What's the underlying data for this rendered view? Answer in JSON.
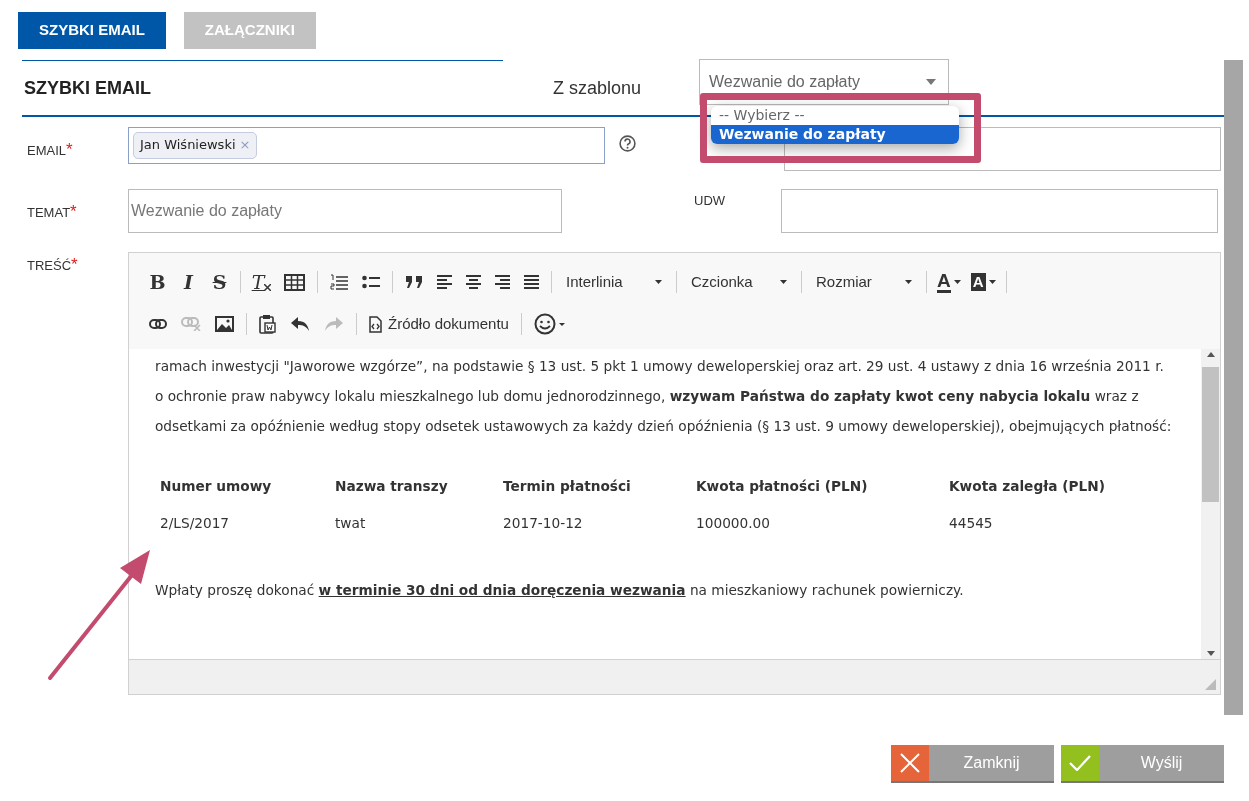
{
  "tabs": [
    {
      "label": "SZYBKI EMAIL",
      "selected": true
    },
    {
      "label": "ZAŁĄCZNIKI",
      "selected": false
    }
  ],
  "header": {
    "title": "SZYBKI EMAIL",
    "template_label": "Z szablonu",
    "template_select": {
      "value": "Wezwanie do zapłaty",
      "expanded": true,
      "options": [
        {
          "label": "-- Wybierz --",
          "selected": false
        },
        {
          "label": "Wezwanie do zapłaty",
          "selected": true
        }
      ]
    }
  },
  "fields": {
    "email": {
      "label": "EMAIL",
      "required_mark": "*",
      "chips": [
        {
          "label": "Jan Wiśniewski",
          "remove": "×"
        }
      ]
    },
    "subject": {
      "label": "TEMAT",
      "required_mark": "*",
      "placeholder": "Wezwanie do zapłaty"
    },
    "udw": {
      "label": "UDW"
    },
    "body": {
      "label": "TREŚĆ",
      "required_mark": "*"
    }
  },
  "toolbar": [
    [
      {
        "kind": "bold",
        "label": "B"
      },
      {
        "kind": "italic",
        "label": "I"
      },
      {
        "kind": "strike",
        "label": "S"
      },
      {
        "kind": "separator"
      },
      {
        "kind": "clear",
        "label": "T"
      },
      {
        "kind": "icon",
        "disabled": false
      },
      {
        "kind": "separator"
      },
      {
        "kind": "icon",
        "disabled": false
      },
      {
        "kind": "icon",
        "disabled": false
      },
      {
        "kind": "separator"
      },
      {
        "kind": "icon",
        "disabled": false
      },
      {
        "kind": "icon",
        "disabled": false
      },
      {
        "kind": "icon",
        "disabled": false
      },
      {
        "kind": "icon",
        "disabled": false
      },
      {
        "kind": "icon",
        "disabled": false
      },
      {
        "kind": "separator"
      },
      {
        "kind": "combo",
        "label": "Interlinia"
      },
      {
        "kind": "separator"
      },
      {
        "kind": "combo",
        "label": "Czcionka"
      },
      {
        "kind": "separator"
      },
      {
        "kind": "combo",
        "label": "Rozmiar"
      },
      {
        "kind": "separator"
      },
      {
        "kind": "color",
        "label": "A"
      },
      {
        "kind": "highlight",
        "label": "A"
      },
      {
        "kind": "separator"
      }
    ],
    [
      {
        "kind": "icon",
        "disabled": false
      },
      {
        "kind": "icon",
        "disabled": true
      },
      {
        "kind": "icon",
        "disabled": false
      },
      {
        "kind": "separator"
      },
      {
        "kind": "icon",
        "disabled": false
      },
      {
        "kind": "icon",
        "disabled": false
      },
      {
        "kind": "icon",
        "disabled": true
      },
      {
        "kind": "separator"
      },
      {
        "kind": "button",
        "label": "Źródło dokumentu"
      },
      {
        "kind": "separator"
      },
      {
        "kind": "icon",
        "disabled": false
      }
    ]
  ],
  "content": {
    "paragraph": "ramach inwestycji \"Jaworowe wzgórze”, na podstawie § 13 ust. 5 pkt 1 umowy deweloperskiej oraz art. 29 ust. 4 ustawy z dnia 16 września 2011 r. o ochronie praw nabywcy lokalu mieszkalnego lub domu jednorodzinnego, **wzywam Państwa do zapłaty kwot ceny nabycia lokalu** wraz z odsetkami za opóźnienie według stopy odsetek ustawowych za każdy dzień opóźnienia (§ 13 ust. 9 umowy deweloperskiej), obejmujących płatność:",
    "table": {
      "columns": [
        "Numer umowy",
        "Nazwa transzy",
        "Termin płatności",
        "Kwota płatności (PLN)",
        "Kwota zaległa (PLN)"
      ],
      "rows": [
        [
          "2/LS/2017",
          "twat",
          "2017-10-12",
          "100000.00",
          "44545"
        ]
      ]
    },
    "closing": {
      "before": "Wpłaty proszę dokonać ",
      "underlined": "w terminie 30 dni od dnia doręczenia wezwania",
      "after": " na mieszkaniowy rachunek powierniczy."
    }
  },
  "buttons": [
    {
      "kind": "close",
      "label": "Zamknij"
    },
    {
      "kind": "send",
      "label": "Wyślij"
    }
  ]
}
